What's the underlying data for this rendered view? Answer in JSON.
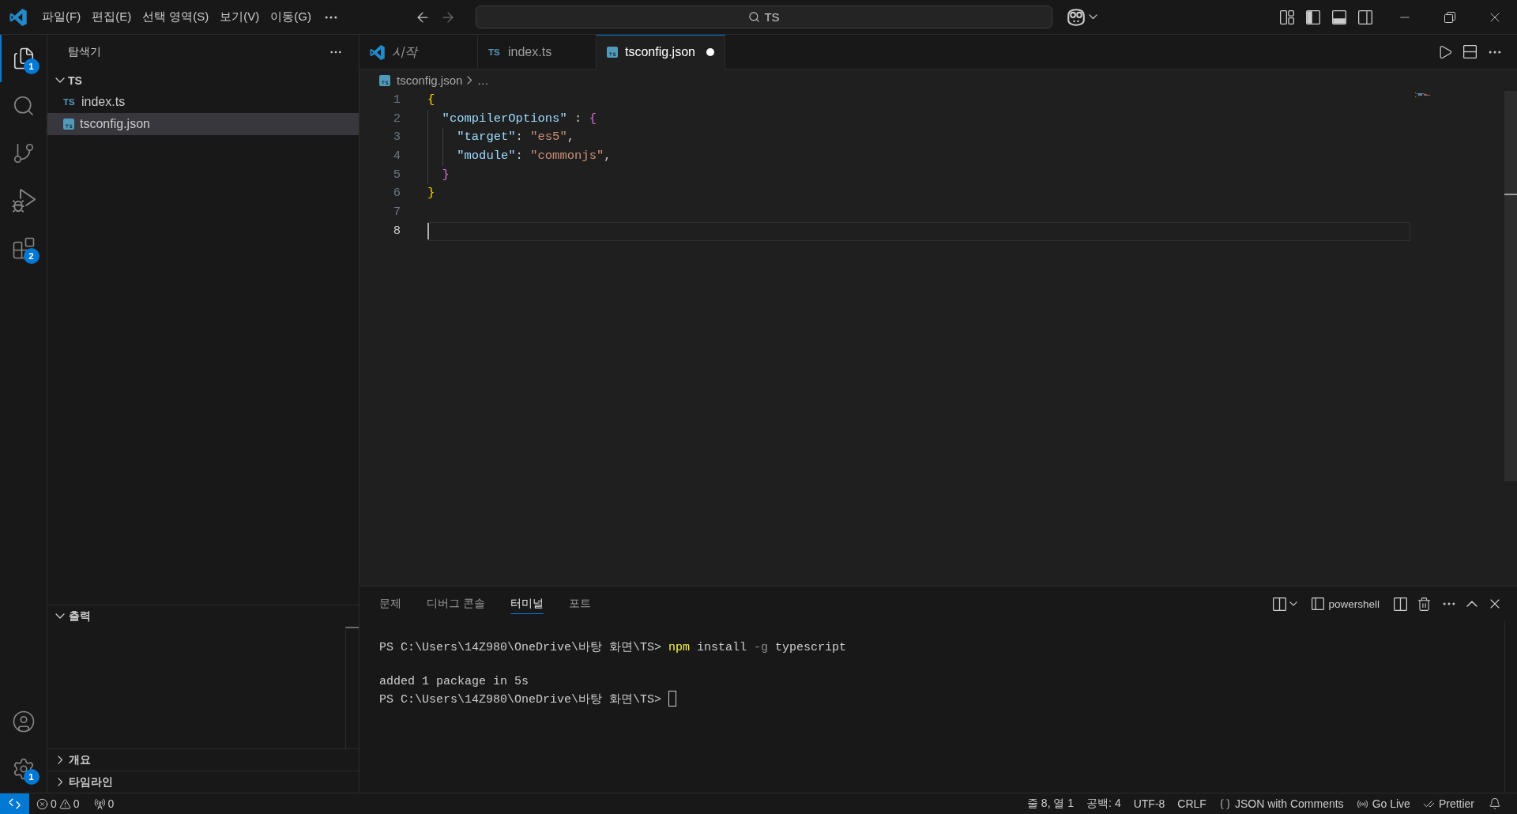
{
  "title_bar": {
    "menus": [
      {
        "label": "파일(F)"
      },
      {
        "label": "편집(E)"
      },
      {
        "label": "선택 영역(S)"
      },
      {
        "label": "보기(V)"
      },
      {
        "label": "이동(G)"
      }
    ],
    "navigation": [
      {
        "kind": "back",
        "disabled": false
      },
      {
        "kind": "forward",
        "disabled": true
      }
    ],
    "command_center": {
      "value": "TS"
    },
    "layout_toggles": [
      {
        "kind": "primary-sidebar",
        "on": true
      },
      {
        "kind": "panel",
        "on": true
      },
      {
        "kind": "secondary-sidebar",
        "on": false
      }
    ]
  },
  "activity_bar": {
    "items": [
      {
        "kind": "explorer",
        "selected": true,
        "badge": "1"
      },
      {
        "kind": "search",
        "selected": false
      },
      {
        "kind": "source-control",
        "selected": false
      },
      {
        "kind": "run-debug",
        "selected": false
      },
      {
        "kind": "extensions",
        "selected": false,
        "badge": "2"
      }
    ],
    "bottom_items": [
      {
        "kind": "accounts"
      },
      {
        "kind": "manage",
        "badge": "1"
      }
    ]
  },
  "sidebar": {
    "title": "탐색기",
    "folder": {
      "name": "TS",
      "expanded": true,
      "children": [
        {
          "name": "index.ts",
          "kind": "ts",
          "icon_label": "TS",
          "selected": false
        },
        {
          "name": "tsconfig.json",
          "kind": "config",
          "selected": true
        }
      ]
    },
    "sections": [
      {
        "title": "출력",
        "expanded": true
      },
      {
        "title": "개요",
        "expanded": false
      },
      {
        "title": "타임라인",
        "expanded": false
      }
    ]
  },
  "editor": {
    "tabs": [
      {
        "label": "시작",
        "kind": "welcome",
        "preview": true,
        "selected": false,
        "dirty": false
      },
      {
        "label": "index.ts",
        "kind": "ts",
        "icon_label": "TS",
        "preview": false,
        "selected": false,
        "dirty": false
      },
      {
        "label": "tsconfig.json",
        "kind": "config",
        "preview": false,
        "selected": true,
        "dirty": true
      }
    ],
    "breadcrumb": [
      {
        "label": "tsconfig.json",
        "kind": "config"
      },
      {
        "label": "…",
        "kind": "symbols"
      }
    ],
    "lines": [
      {
        "number": "1",
        "current": false,
        "tokens": [
          {
            "text": "{",
            "kind": "bracket1"
          }
        ]
      },
      {
        "number": "2",
        "current": false,
        "tokens": [
          {
            "text": "  \"compilerOptions\"",
            "kind": "key"
          },
          {
            "text": " : ",
            "kind": "punct"
          },
          {
            "text": "{",
            "kind": "bracket2"
          }
        ]
      },
      {
        "number": "3",
        "current": false,
        "tokens": [
          {
            "text": "    \"target\"",
            "kind": "key"
          },
          {
            "text": ": ",
            "kind": "punct"
          },
          {
            "text": "\"es5\"",
            "kind": "string"
          },
          {
            "text": ",",
            "kind": "punct"
          }
        ]
      },
      {
        "number": "4",
        "current": false,
        "tokens": [
          {
            "text": "    \"module\"",
            "kind": "key"
          },
          {
            "text": ": ",
            "kind": "punct"
          },
          {
            "text": "\"commonjs\"",
            "kind": "string"
          },
          {
            "text": ",",
            "kind": "punct"
          }
        ]
      },
      {
        "number": "5",
        "current": false,
        "tokens": [
          {
            "text": "  }",
            "kind": "bracket2"
          }
        ]
      },
      {
        "number": "6",
        "current": false,
        "tokens": [
          {
            "text": "}",
            "kind": "bracket1"
          }
        ]
      },
      {
        "number": "7",
        "current": false
      },
      {
        "number": "8",
        "current": true
      }
    ]
  },
  "panel": {
    "tabs": [
      {
        "label": "문제",
        "selected": false
      },
      {
        "label": "디버그 콘솔",
        "selected": false
      },
      {
        "label": "터미널",
        "selected": true
      },
      {
        "label": "포트",
        "selected": false
      }
    ],
    "terminal_profile": "powershell",
    "terminal": [
      {
        "kind": "command",
        "cursor": false,
        "segments": [
          {
            "text": "PS C:\\Users\\14Z980\\OneDrive\\바탕 화면\\TS> ",
            "kind": "plain"
          },
          {
            "text": "npm",
            "kind": "command"
          },
          {
            "text": " install ",
            "kind": "plain"
          },
          {
            "text": "-g",
            "kind": "flag"
          },
          {
            "text": " typescript",
            "kind": "plain"
          }
        ]
      },
      {
        "kind": "output",
        "cursor": false,
        "segments": [
          {
            "text": "added 1 package in 5s",
            "kind": "plain"
          }
        ]
      },
      {
        "kind": "prompt",
        "cursor": true,
        "segments": [
          {
            "text": "PS C:\\Users\\14Z980\\OneDrive\\바탕 화면\\TS>",
            "kind": "plain"
          }
        ]
      }
    ]
  },
  "status_bar": {
    "errors": "0",
    "warnings": "0",
    "ports": "0",
    "items": [
      {
        "label": "줄 8, 열 1",
        "kind": "text"
      },
      {
        "label": "공백: 4",
        "kind": "text"
      },
      {
        "label": "UTF-8",
        "kind": "text"
      },
      {
        "label": "CRLF",
        "kind": "text"
      },
      {
        "label": "JSON with Comments",
        "kind": "language"
      },
      {
        "label": "Go Live",
        "kind": "live"
      },
      {
        "label": "Prettier",
        "kind": "prettier"
      }
    ]
  }
}
